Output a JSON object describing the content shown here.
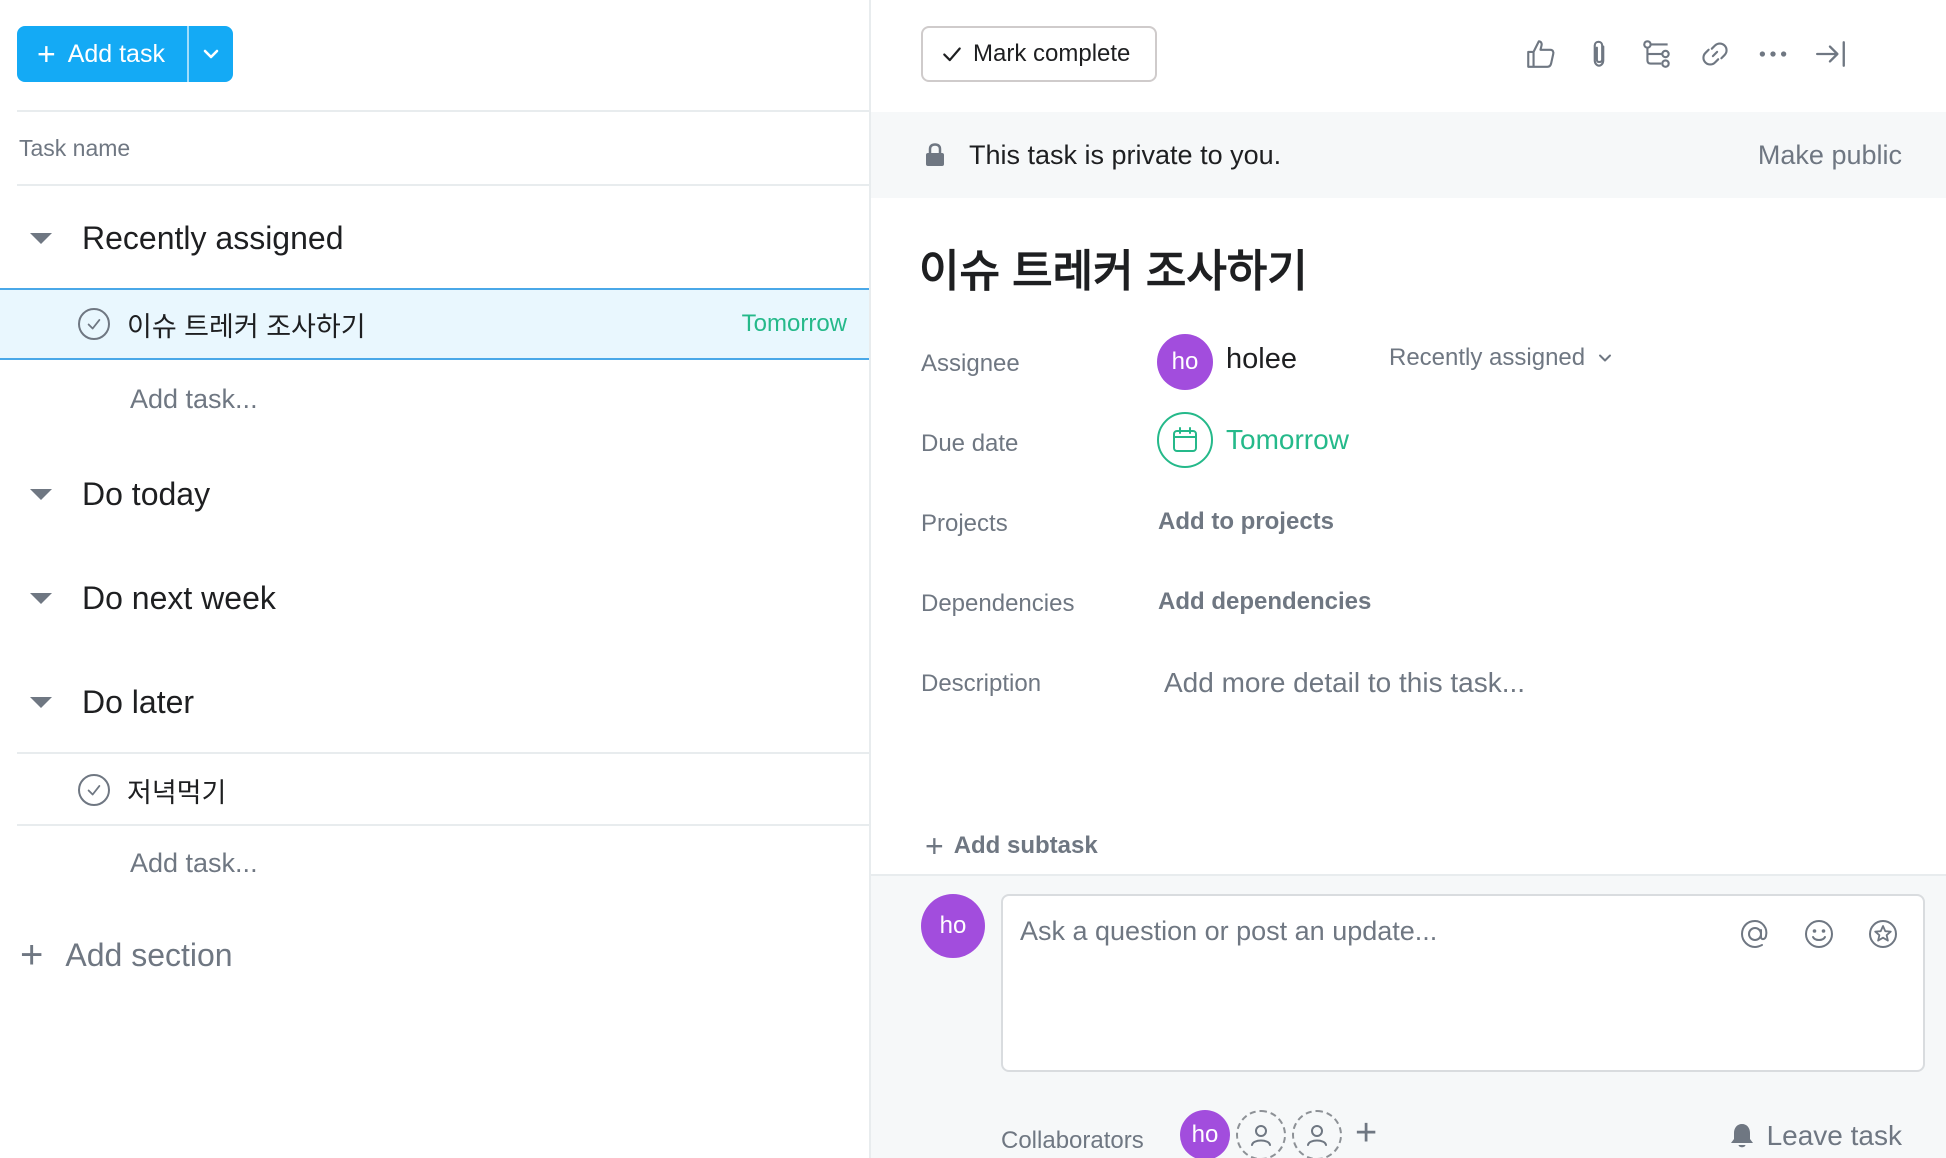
{
  "toolbar": {
    "add_task_label": "Add task"
  },
  "list": {
    "column_header": "Task name",
    "sections": [
      {
        "title": "Recently assigned"
      },
      {
        "title": "Do today"
      },
      {
        "title": "Do next week"
      },
      {
        "title": "Do later"
      }
    ],
    "tasks": [
      {
        "name": "이슈 트레커 조사하기",
        "due": "Tomorrow",
        "section": "Recently assigned"
      },
      {
        "name": "저녁먹기",
        "due": "",
        "section": "Do later"
      }
    ],
    "add_task_placeholder": "Add task...",
    "add_section_label": "Add section"
  },
  "detail": {
    "mark_complete_label": "Mark complete",
    "privacy_text": "This task is private to you.",
    "make_public_label": "Make public",
    "title": "이슈 트레커 조사하기",
    "fields": {
      "assignee_label": "Assignee",
      "assignee_initials": "ho",
      "assignee_name": "holee",
      "assignee_section": "Recently assigned",
      "due_label": "Due date",
      "due_value": "Tomorrow",
      "projects_label": "Projects",
      "projects_action": "Add to projects",
      "dependencies_label": "Dependencies",
      "dependencies_action": "Add dependencies",
      "description_label": "Description",
      "description_placeholder": "Add more detail to this task..."
    },
    "add_subtask_label": "Add subtask",
    "comment": {
      "avatar_initials": "ho",
      "placeholder": "Ask a question or post an update..."
    },
    "collaborators_label": "Collaborators",
    "collaborator_initials": "ho",
    "leave_task_label": "Leave task"
  },
  "colors": {
    "primary": "#14aaf5",
    "due_green": "#25b98a",
    "avatar_purple": "#a24ddd",
    "selected_row": "#e9f7fe",
    "muted_text": "#6f7782"
  },
  "icons": [
    "plus-icon",
    "chevron-down-icon",
    "checkmark-icon",
    "like-icon",
    "attachment-icon",
    "subtask-icon",
    "link-icon",
    "more-icon",
    "close-pane-icon",
    "lock-icon",
    "calendar-icon",
    "mention-icon",
    "emoji-icon",
    "star-icon",
    "user-icon",
    "bell-icon"
  ]
}
